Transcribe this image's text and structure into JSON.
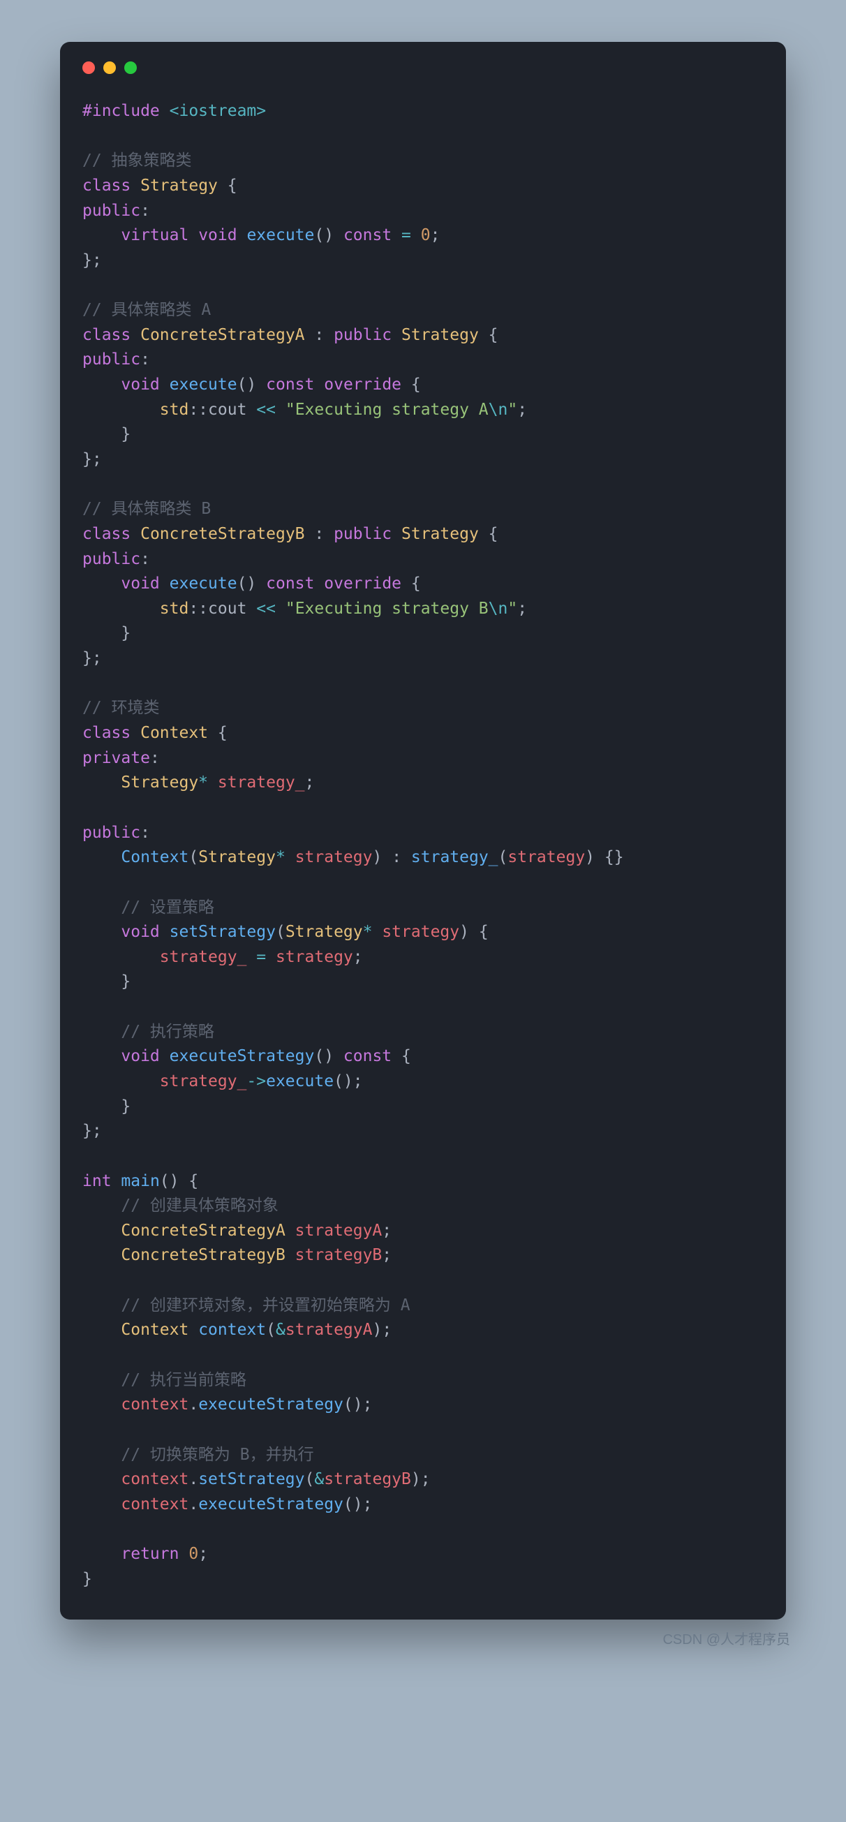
{
  "window": {
    "dots": [
      "red",
      "yellow",
      "green"
    ]
  },
  "code": {
    "l1_pp": "#include",
    "l1_inc": "<iostream>",
    "c1": "// 抽象策略类",
    "kw_class": "class",
    "ty_Strategy": "Strategy",
    "pn_space_ob": " {",
    "kw_public": "public",
    "pn_colon": ":",
    "kw_virtual": "virtual",
    "kw_void": "void",
    "fn_execute": "execute",
    "pn_par": "()",
    "kw_const": "const",
    "op_eq": "=",
    "num_0": "0",
    "pn_semi": ";",
    "pn_cb_semi": "};",
    "c2": "// 具体策略类 A",
    "ty_ConA": "ConcreteStrategyA",
    "pn_sp_colon_sp": " : ",
    "kw_override": "override",
    "pn_sp_ob": " {",
    "std": "std",
    "dcolon": "::",
    "cout": "cout",
    "op_ins": "<<",
    "str_a1": "\"Executing strategy A",
    "esc_n": "\\n",
    "str_close": "\"",
    "pn_cb": "}",
    "c3": "// 具体策略类 B",
    "ty_ConB": "ConcreteStrategyB",
    "str_b1": "\"Executing strategy B",
    "c4": "// 环境类",
    "ty_Context": "Context",
    "kw_private": "private",
    "op_star": "*",
    "var_strat_": "strategy_",
    "fn_Context": "Context",
    "var_strategy": "strategy",
    "pn_lp": "(",
    "pn_rp": ")",
    "pn_braces": "{}",
    "c5": "// 设置策略",
    "fn_setStrategy": "setStrategy",
    "c6": "// 执行策略",
    "fn_execStrat": "executeStrategy",
    "op_arrow": "->",
    "kw_int": "int",
    "fn_main": "main",
    "c7": "// 创建具体策略对象",
    "var_strategyA": "strategyA",
    "var_strategyB": "strategyB",
    "c8": "// 创建环境对象，并设置初始策略为 A",
    "var_context": "context",
    "op_amp": "&",
    "c9": "// 执行当前策略",
    "c10": "// 切换策略为 B，并执行",
    "pn_dot": ".",
    "kw_return": "return"
  },
  "watermark": "CSDN @人才程序员"
}
